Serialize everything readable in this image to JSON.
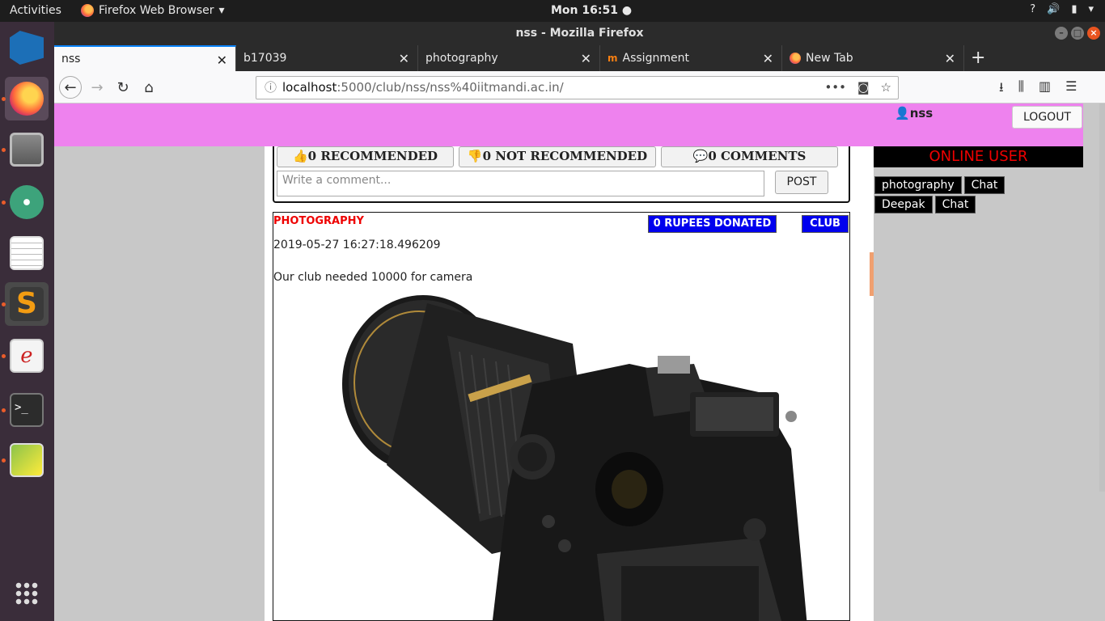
{
  "system": {
    "activities": "Activities",
    "app_name": "Firefox Web Browser",
    "clock": "Mon 16:51"
  },
  "window": {
    "title": "nss - Mozilla Firefox"
  },
  "tabs": [
    {
      "label": "nss"
    },
    {
      "label": "b17039"
    },
    {
      "label": "photography"
    },
    {
      "label": "Assignment"
    },
    {
      "label": "New Tab"
    }
  ],
  "url": {
    "host": "localhost",
    "path": ":5000/club/nss/nss%40iitmandi.ac.in/"
  },
  "header": {
    "username": "nss",
    "logout": "LOGOUT"
  },
  "post_actions": {
    "recommended": "0 RECOMMENDED",
    "not_recommended": "0 NOT RECOMMENDED",
    "comments": "0 COMMENTS",
    "comment_placeholder": "Write a comment...",
    "post_button": "POST"
  },
  "post": {
    "category": "PHOTOGRAPHY",
    "donated": "0 RUPEES DONATED",
    "type": "CLUB",
    "timestamp": "2019-05-27 16:27:18.496209",
    "description": "Our club needed 10000 for camera"
  },
  "online_users": {
    "title": "ONLINE USER",
    "users": [
      {
        "name": "photography",
        "action": "Chat"
      },
      {
        "name": "Deepak",
        "action": "Chat"
      }
    ]
  },
  "colors": {
    "header_bg": "#ee82ee",
    "donate_bg": "#0000ee",
    "online_title": "#ee0000"
  }
}
